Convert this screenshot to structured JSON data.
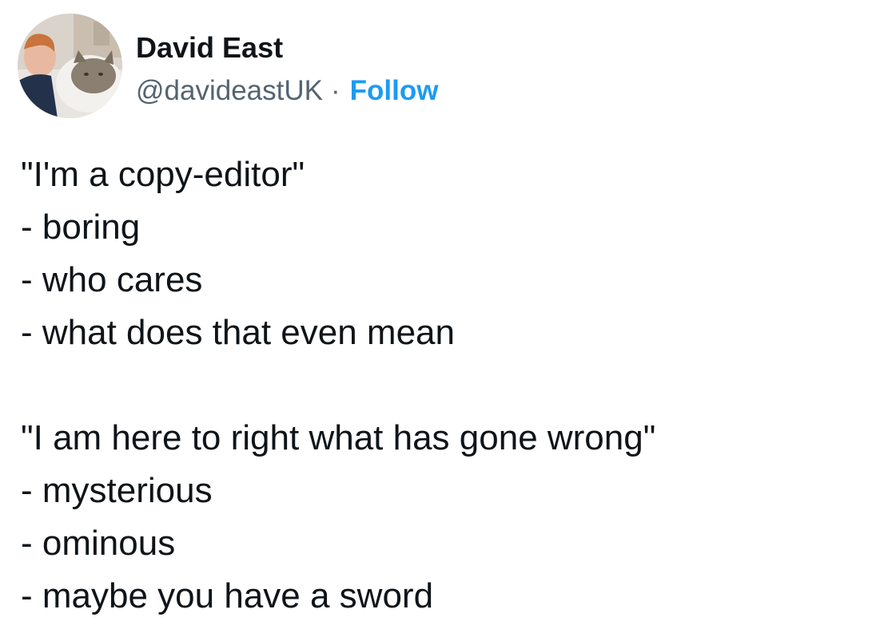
{
  "author": {
    "name": "David East",
    "handle": "@davideastUK",
    "separator": "·",
    "follow_label": "Follow",
    "avatar_icon": "profile-photo"
  },
  "colors": {
    "text": "#0f1419",
    "secondary": "#536471",
    "accent": "#1d9bf0",
    "background": "#ffffff"
  },
  "tweet": {
    "paragraph1": {
      "quote": "\"I'm a copy-editor\"",
      "items": [
        "- boring",
        "- who cares",
        "- what does that even mean"
      ]
    },
    "paragraph2": {
      "quote": "\"I am here to right what has gone wrong\"",
      "items": [
        "- mysterious",
        "- ominous",
        "- maybe you have a sword"
      ]
    }
  }
}
